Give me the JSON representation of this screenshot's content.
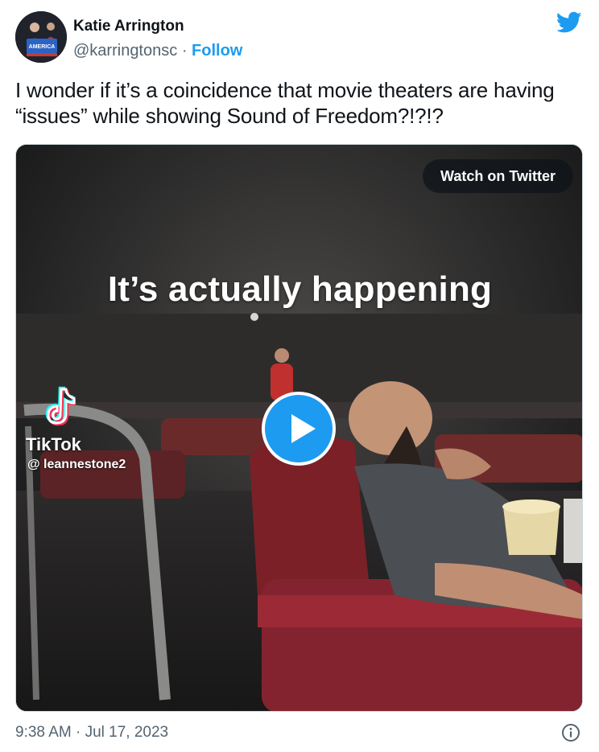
{
  "author": {
    "name": "Katie Arrington",
    "handle": "@karringtonsc",
    "separator": "·",
    "follow_label": "Follow",
    "avatar_sign_text": "AMERICA"
  },
  "tweet": {
    "text": "I wonder if it’s a coincidence that movie theaters are having “issues” while showing Sound of Freedom?!?!?",
    "timestamp": "9:38 AM · Jul 17, 2023"
  },
  "media": {
    "watch_button": "Watch on Twitter",
    "overlay_caption": "It’s actually happening",
    "tiktok_brand": "TikTok",
    "tiktok_handle": "@ leannestone2"
  },
  "icons": {
    "bird": "twitter-bird-icon",
    "play": "play-icon",
    "info": "info-icon",
    "tiktok": "tiktok-logo-icon"
  },
  "colors": {
    "accent": "#1d9bf0",
    "text": "#0f1419",
    "muted": "#536471",
    "border": "#cfd9de"
  }
}
